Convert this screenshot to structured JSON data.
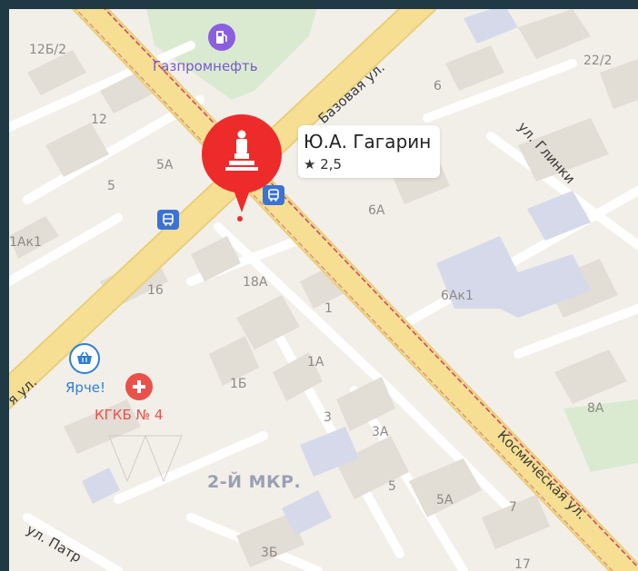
{
  "map": {
    "streets": {
      "bazovaya": "Базовая ул.",
      "glinki": "ул. Глинки",
      "kosmicheskaya": "Космическая ул.",
      "left_cut": "я ул.",
      "patr": "ул. Патр"
    },
    "buildings": {
      "b_12b2": "12Б/2",
      "b_12": "12",
      "b_5a_left": "5А",
      "b_5_left": "5",
      "b_1ak1": "1Ак1",
      "b_16": "16",
      "b_18a": "18А",
      "b_1": "1",
      "b_1a": "1А",
      "b_1b": "1Б",
      "b_3": "3",
      "b_3a": "3А",
      "b_5": "5",
      "b_5a": "5А",
      "b_7": "7",
      "b_17": "17",
      "b_3b": "3Б",
      "b_6": "6",
      "b_22_2": "22/2",
      "b_6a": "6А",
      "b_6ak1": "6Ак1",
      "b_8a": "8А"
    },
    "district": "2-Й МКР.",
    "pois": {
      "gazprom": "Газпромнефть",
      "yarche": "Ярче!",
      "hospital": "КГКБ № 4"
    },
    "marker": {
      "title": "Ю.А. Гагарин",
      "rating": "2,5",
      "rating_icon": "star-icon",
      "pin_icon": "monument-icon"
    },
    "colors": {
      "background": "#f2efe9",
      "main_road": "#f3dc8f",
      "marker_red": "#ee2b2b",
      "gas_purple": "#8b5ee0",
      "medical_red": "#e8524a",
      "shop_blue": "#2d7fd6",
      "transit_blue": "#3c72d6",
      "tram_line": "#cc4a6b"
    }
  }
}
